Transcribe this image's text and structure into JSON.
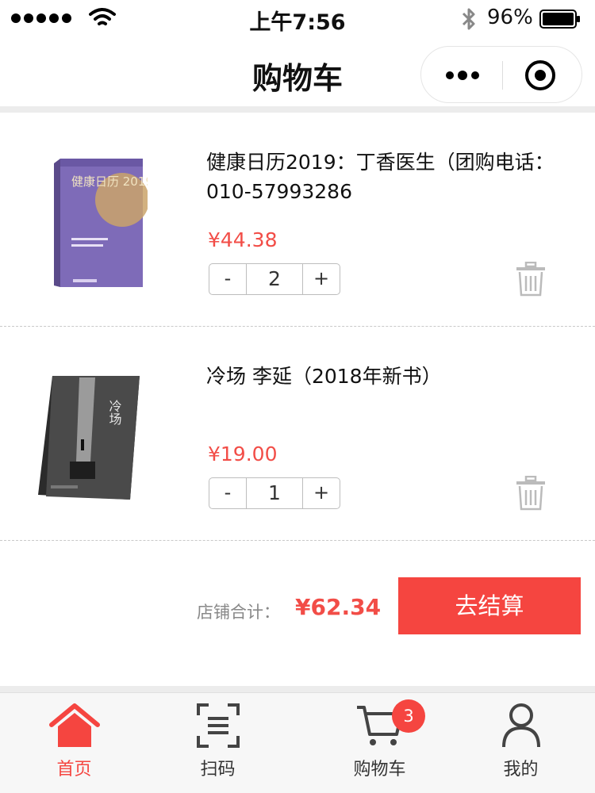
{
  "status_bar": {
    "time": "上午7:56",
    "battery": "96%",
    "icons": [
      "signal-dots-icon",
      "wifi-icon",
      "bluetooth-icon",
      "battery-icon"
    ]
  },
  "nav": {
    "title": "购物车",
    "capsule_icons": [
      "more-icon",
      "close-target-icon"
    ]
  },
  "cart": {
    "items": [
      {
        "title": "健康日历2019：丁香医生（团购电话：010-57993286",
        "price": "¥44.38",
        "quantity": "2",
        "minus": "-",
        "plus": "+",
        "cover_text": "健康日历 2019"
      },
      {
        "title": "冷场 李延（2018年新书）",
        "price": "¥19.00",
        "quantity": "1",
        "minus": "-",
        "plus": "+",
        "cover_text": "冷场"
      }
    ],
    "total_label": "店铺合计：",
    "total_value": "¥62.34",
    "checkout_label": "去结算"
  },
  "tab_bar": {
    "items": [
      {
        "label": "首页",
        "icon": "home-icon",
        "active": true
      },
      {
        "label": "扫码",
        "icon": "scan-icon",
        "active": false
      },
      {
        "label": "购物车",
        "icon": "cart-icon",
        "active": false,
        "badge": "3"
      },
      {
        "label": "我的",
        "icon": "user-icon",
        "active": false
      }
    ]
  },
  "colors": {
    "accent": "#f54540",
    "price": "#f24d47",
    "band": "#ececec"
  }
}
